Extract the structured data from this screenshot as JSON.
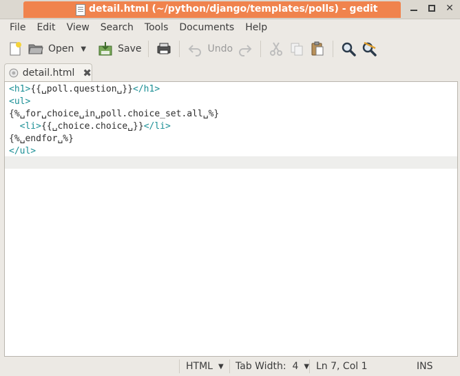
{
  "window": {
    "title": "detail.html (~/python/django/templates/polls) - gedit"
  },
  "menu": [
    "File",
    "Edit",
    "View",
    "Search",
    "Tools",
    "Documents",
    "Help"
  ],
  "toolbar": {
    "open_label": "Open",
    "save_label": "Save",
    "undo_label": "Undo"
  },
  "tab": {
    "label": "detail.html"
  },
  "editor": {
    "lines": [
      {
        "tag1": "<h1>",
        "text": "{{␣poll.question␣}}",
        "tag2": "</h1>"
      },
      {
        "tag1": "<ul>",
        "text": "",
        "tag2": ""
      },
      {
        "tag1": "",
        "text": "{%␣for␣choice␣in␣poll.choice_set.all␣%}",
        "tag2": ""
      },
      {
        "tag1": "  <li>",
        "text": "{{␣choice.choice␣}}",
        "tag2": "</li>"
      },
      {
        "tag1": "",
        "text": "{%␣endfor␣%}",
        "tag2": ""
      },
      {
        "tag1": "</ul>",
        "text": "",
        "tag2": ""
      }
    ]
  },
  "status": {
    "language": "HTML",
    "tab_width": "Tab Width:  4",
    "position": "Ln 7, Col 1",
    "mode": "INS"
  }
}
